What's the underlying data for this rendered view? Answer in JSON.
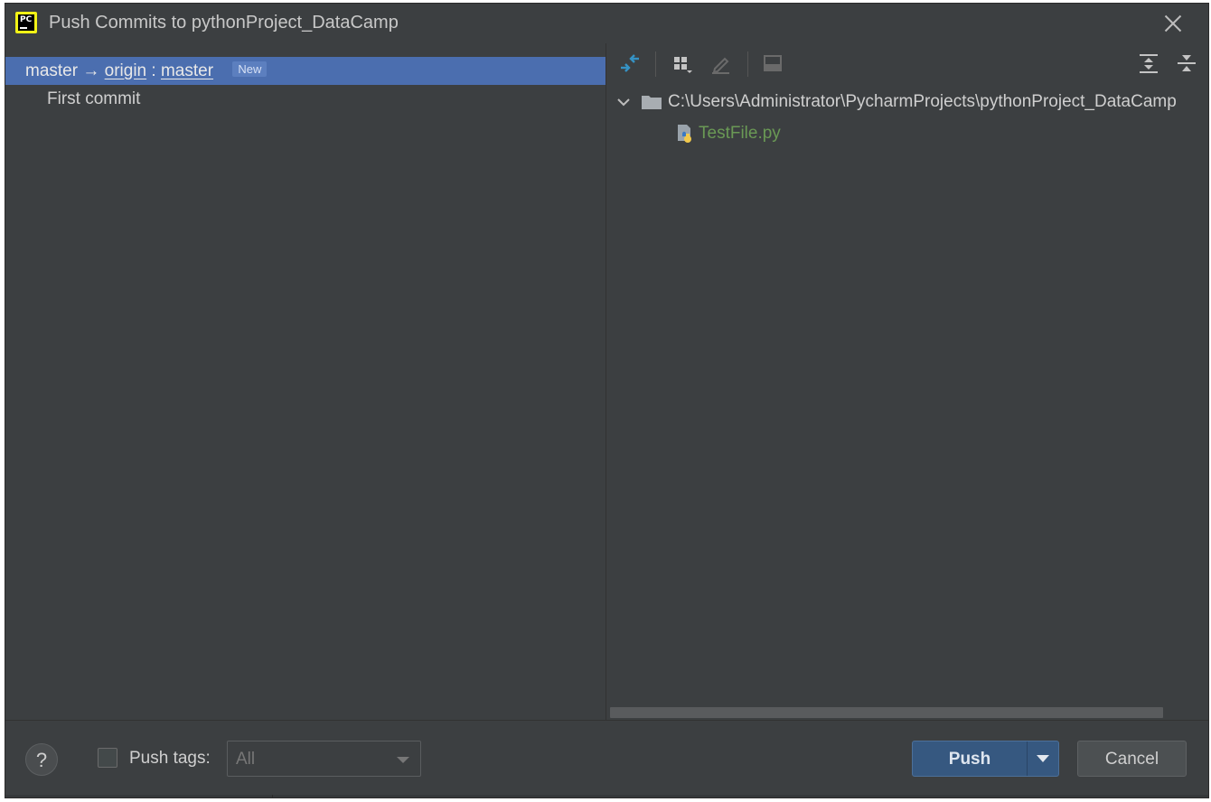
{
  "window": {
    "title": "Push Commits to pythonProject_DataCamp"
  },
  "left_panel": {
    "branch": {
      "local": "master",
      "arrow": "→",
      "remote": "origin",
      "separator": ":",
      "remote_branch": "master",
      "badge": "New"
    },
    "commits": [
      "First commit"
    ]
  },
  "right_panel": {
    "toolbar_icons": [
      "expand-diff-icon",
      "group-by-icon",
      "edit-icon",
      "preview-icon",
      "expand-all-icon",
      "collapse-all-icon"
    ],
    "tree": {
      "folder_path": "C:\\Users\\Administrator\\PycharmProjects\\pythonProject_DataCamp",
      "files": [
        "TestFile.py"
      ]
    }
  },
  "bottom": {
    "help_label": "?",
    "push_tags_label": "Push tags:",
    "push_tags_checked": false,
    "tags_select_value": "All",
    "push_label": "Push",
    "cancel_label": "Cancel"
  },
  "colors": {
    "background": "#3c3f41",
    "selection": "#4b6eaf",
    "primary_button": "#365880",
    "added_file": "#6a9955"
  }
}
